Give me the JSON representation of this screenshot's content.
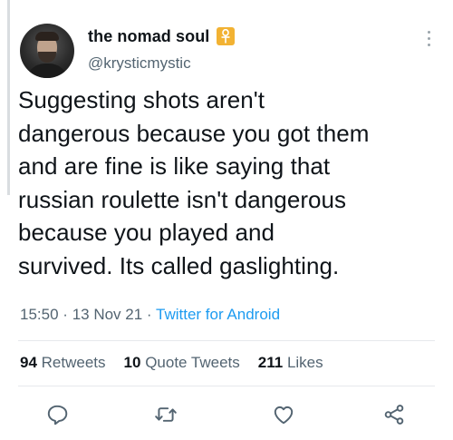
{
  "author": {
    "display_name": "the nomad soul",
    "handle": "@krysticmystic",
    "badge_icon": "ankh-badge-icon",
    "badge_color": "#f2b233"
  },
  "tweet": {
    "text": "Suggesting shots aren't\ndangerous because you got them\nand are fine is like saying that\nrussian roulette isn't dangerous\nbecause you played and\nsurvived. Its called gaslighting.",
    "time": "15:50",
    "separator": "·",
    "date": "13 Nov 21",
    "source": "Twitter for Android"
  },
  "stats": {
    "retweets_count": "94",
    "retweets_label": "Retweets",
    "quote_count": "10",
    "quote_label": "Quote Tweets",
    "likes_count": "211",
    "likes_label": "Likes"
  },
  "actions": [
    {
      "icon": "reply-icon"
    },
    {
      "icon": "retweet-icon"
    },
    {
      "icon": "like-icon"
    },
    {
      "icon": "share-icon"
    }
  ],
  "colors": {
    "link": "#1d9bf0",
    "secondary_text": "#536471",
    "primary_text": "#0f1419"
  }
}
